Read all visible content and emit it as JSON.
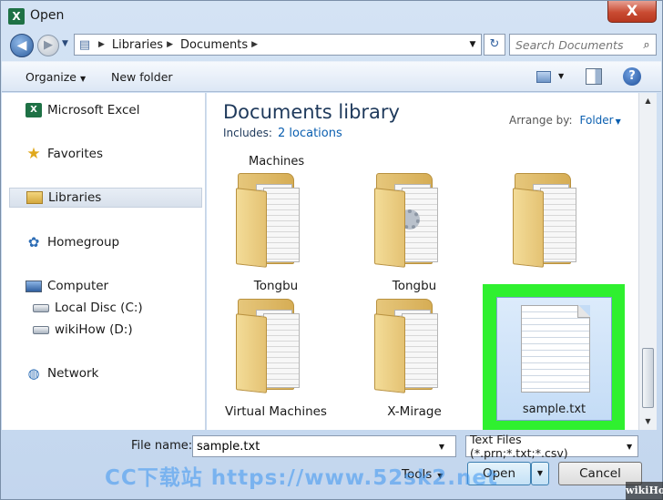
{
  "window": {
    "title": "Open",
    "close_label": "X"
  },
  "address": {
    "crumbs": [
      "Libraries",
      "Documents"
    ],
    "search_placeholder": "Search Documents"
  },
  "toolbar": {
    "organize": "Organize",
    "new_folder": "New folder",
    "help": "?"
  },
  "sidebar": {
    "items": [
      {
        "label": "Microsoft Excel",
        "icon": "excel-icon"
      },
      {
        "label": "Favorites",
        "icon": "star-icon"
      },
      {
        "label": "Libraries",
        "icon": "libraries-icon",
        "selected": true
      },
      {
        "label": "Homegroup",
        "icon": "homegroup-icon"
      },
      {
        "label": "Computer",
        "icon": "computer-icon"
      },
      {
        "label": "Local Disc (C:)",
        "icon": "disc-icon"
      },
      {
        "label": "wikiHow (D:)",
        "icon": "disc-icon"
      },
      {
        "label": "Network",
        "icon": "network-icon"
      }
    ]
  },
  "library": {
    "title": "Documents library",
    "includes_label": "Includes:",
    "includes_link": "2 locations",
    "arrange_label": "Arrange by:",
    "arrange_value": "Folder",
    "group_label": "Machines"
  },
  "items": [
    {
      "label": "Tongbu",
      "icon": "folder-icon"
    },
    {
      "label": "Tongbu",
      "icon": "folder-icon"
    },
    {
      "label": "Virtual Machines",
      "icon": "folder-icon"
    },
    {
      "label": "X-Mirage",
      "icon": "folder-icon"
    },
    {
      "label": "sample.txt",
      "icon": "text-file-icon",
      "selected": true
    }
  ],
  "bottom": {
    "filename_label": "File name:",
    "filename_value": "sample.txt",
    "filetype_value": "Text Files (*.prn;*.txt;*.csv)",
    "tools": "Tools",
    "open": "Open",
    "cancel": "Cancel"
  },
  "overlays": {
    "watermark": "CC下载站 https://www.52sk2.net",
    "brand": "wikiHow"
  },
  "colors": {
    "highlight": "#2ff02f",
    "link": "#0b5fb0",
    "close": "#c94b32"
  }
}
